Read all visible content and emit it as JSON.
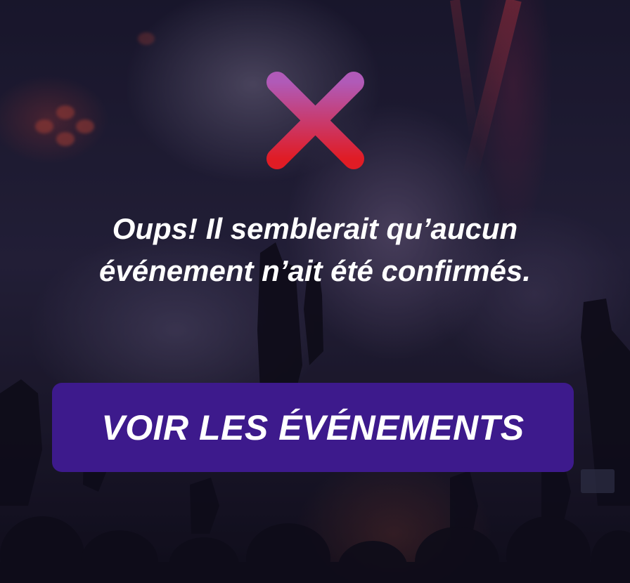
{
  "icons": {
    "error": "close-icon",
    "error_gradient": [
      "#b05ab8",
      "#e01c25"
    ]
  },
  "message": {
    "text": "Oups! Il semblerait qu’aucun événement n’ait été confirmés."
  },
  "cta": {
    "label": "VOIR LES ÉVÉNEMENTS",
    "color": "#3d1a8c"
  },
  "colors": {
    "text": "#ffffff"
  }
}
